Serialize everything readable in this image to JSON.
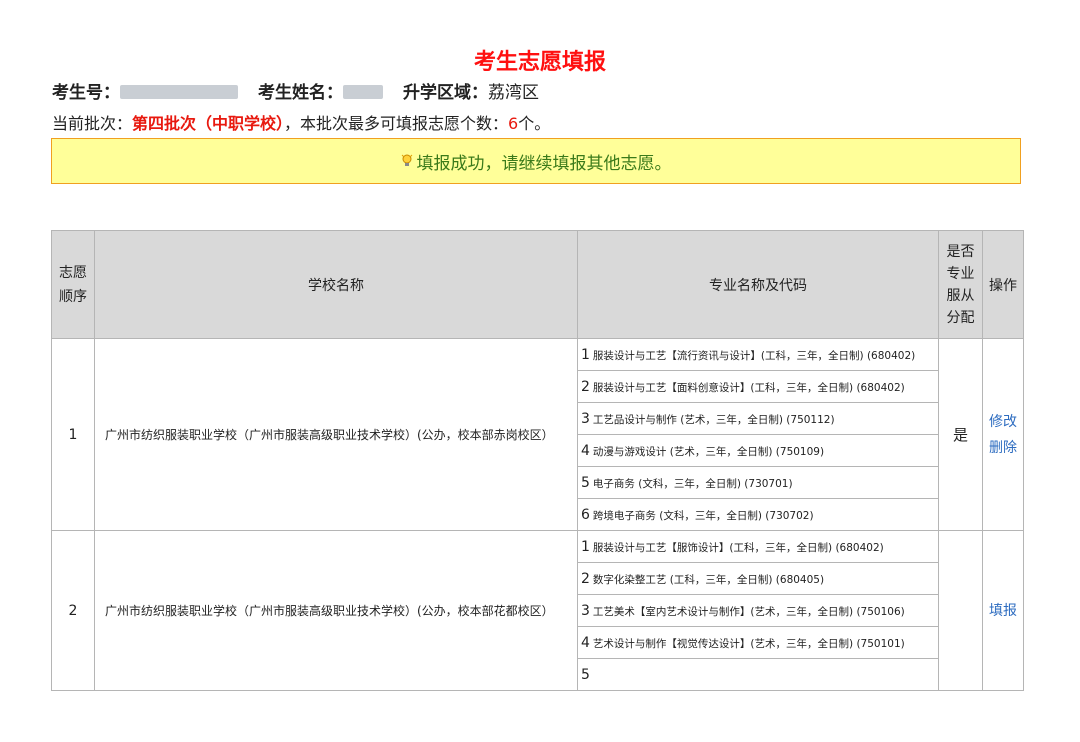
{
  "page_title": "考生志愿填报",
  "info": {
    "exam_no_label": "考生号：",
    "name_label": "考生姓名：",
    "region_label": "升学区域：",
    "region_value": "荔湾区"
  },
  "batch": {
    "prefix": "当前批次：",
    "name": "第四批次（中职学校）",
    "middle": "，本批次最多可填报志愿个数：",
    "count": "6",
    "suffix": "个。"
  },
  "notice": {
    "icon": "lightbulb-icon",
    "text": "填报成功，请继续填报其他志愿。"
  },
  "table": {
    "headers": {
      "seq": [
        "志愿",
        "顺序"
      ],
      "school": "学校名称",
      "major": "专业名称及代码",
      "assign": [
        "是否",
        "专业",
        "服从",
        "分配"
      ],
      "op": "操作"
    },
    "rows": [
      {
        "seq": "1",
        "school": "广州市纺织服装职业学校（广州市服装高级职业技术学校）(公办，校本部赤岗校区）",
        "majors": [
          {
            "num": "1",
            "text": "服装设计与工艺【流行资讯与设计】(工科，三年，全日制) (680402)"
          },
          {
            "num": "2",
            "text": "服装设计与工艺【面料创意设计】(工科，三年，全日制) (680402)"
          },
          {
            "num": "3",
            "text": "工艺品设计与制作 (艺术，三年，全日制) (750112)"
          },
          {
            "num": "4",
            "text": "动漫与游戏设计 (艺术，三年，全日制) (750109)"
          },
          {
            "num": "5",
            "text": "电子商务 (文科，三年，全日制) (730701)"
          },
          {
            "num": "6",
            "text": "跨境电子商务 (文科，三年，全日制) (730702)"
          }
        ],
        "assign": "是",
        "ops": [
          "修改",
          "删除"
        ]
      },
      {
        "seq": "2",
        "school": "广州市纺织服装职业学校（广州市服装高级职业技术学校）(公办，校本部花都校区）",
        "majors": [
          {
            "num": "1",
            "text": "服装设计与工艺【服饰设计】(工科，三年，全日制) (680402)"
          },
          {
            "num": "2",
            "text": "数字化染整工艺 (工科，三年，全日制) (680405)"
          },
          {
            "num": "3",
            "text": "工艺美术【室内艺术设计与制作】(艺术，三年，全日制) (750106)"
          },
          {
            "num": "4",
            "text": "艺术设计与制作【视觉传达设计】(艺术，三年，全日制) (750101)"
          },
          {
            "num": "5",
            "text": ""
          }
        ],
        "assign": "",
        "ops": [
          "填报"
        ]
      }
    ]
  }
}
